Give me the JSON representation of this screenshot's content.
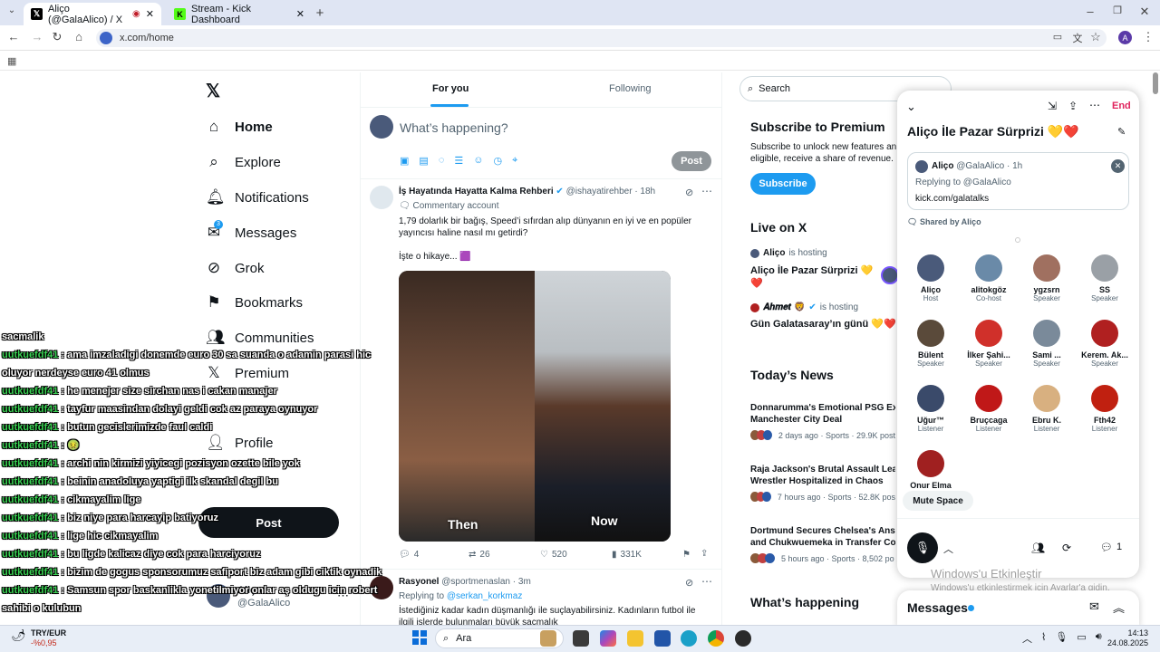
{
  "browser": {
    "tabs": [
      {
        "title": "Aliço (@GalaAlico) / X",
        "active": true
      },
      {
        "title": "Stream - Kick Dashboard",
        "active": false
      }
    ],
    "url": "x.com/home",
    "profile_initial": "A"
  },
  "nav": {
    "items": [
      {
        "label": "Home"
      },
      {
        "label": "Explore"
      },
      {
        "label": "Notifications"
      },
      {
        "label": "Messages",
        "badge": "3"
      },
      {
        "label": "Grok"
      },
      {
        "label": "Bookmarks"
      },
      {
        "label": "Communities"
      },
      {
        "label": "Premium"
      },
      {
        "label": "Profile"
      }
    ],
    "post_label": "Post",
    "account_handle": "@GalaAlico",
    "account_name": "Aliço"
  },
  "chat": {
    "lines": [
      {
        "user": "",
        "text": "sacmalik"
      },
      {
        "user": "uutkuefdf41",
        "text": " : ama imzaladigi donemde euro 30 sa suanda o adamin parasi hic"
      },
      {
        "user": "",
        "text": "oluyor nerdeyse euro 41 olmus"
      },
      {
        "user": "uutkuefdf41",
        "text": " : he menejer size sirchan nas i cakan manajer"
      },
      {
        "user": "uutkuefdf41",
        "text": " : tayfur maasindan dolayi geldi cok az paraya oynuyor"
      },
      {
        "user": "uutkuefdf41",
        "text": " : butun gecislerimizde faul caldi"
      },
      {
        "user": "uutkuefdf41",
        "text": " : 🤢"
      },
      {
        "user": "uutkuefdf41",
        "text": " : archi nin kirmizi yiyicegi pozisyon ozette bile yok"
      },
      {
        "user": "uutkuefdf41",
        "text": " : beinin anadoluya yaptigi ilk skandal degil bu"
      },
      {
        "user": "uutkuefdf41",
        "text": " : cikmayalim lige"
      },
      {
        "user": "uutkuefdf41",
        "text": " : biz niye para harcayip batiyoruz"
      },
      {
        "user": "uutkuefdf41",
        "text": " : lige hic cikmayalim"
      },
      {
        "user": "uutkuefdf41",
        "text": " : bu ligde kalicaz diye cok para harciyoruz"
      },
      {
        "user": "uutkuefdf41",
        "text": " : bizim de gogus sponsorumuz safiport biz adam gibi ciktik oynadik"
      },
      {
        "user": "uutkuefdf41",
        "text": " : Samsun spor baskanlikla yonetilmiyor onlar aş oldugu icin robert"
      },
      {
        "user": "",
        "text": "sahibi o kulubun"
      }
    ]
  },
  "timeline": {
    "tabs": [
      {
        "label": "For you",
        "active": true
      },
      {
        "label": "Following",
        "active": false
      }
    ],
    "composer_placeholder": "What’s happening?",
    "post_label": "Post",
    "tweet1": {
      "name": "İş Hayatında Hayatta Kalma Rehberi",
      "handle": "@ishayatirehber",
      "time": "· 18h",
      "badge": "Commentary account",
      "text": "1,79 dolarlık bir bağış, Speed’i sıfırdan alıp dünyanın en iyi ve en popüler yayıncısı haline nasıl mı getirdi?",
      "text2": "İşte o hikaye... 🟪",
      "img_left": "Then",
      "img_right": "Now",
      "replies": "4",
      "reposts": "26",
      "likes": "520",
      "views": "331K"
    },
    "tweet2": {
      "name": "Rasyonel",
      "handle": "@sportmenaslan",
      "time": "· 3m",
      "reply_to_prefix": "Replying to ",
      "reply_to": "@serkan_korkmaz",
      "text": "İstediğiniz kadar kadın düşmanlığı ile suçlayabilirsiniz. Kadınların futbol ile ilgili islerde bulunmaları büyük saçmalık"
    }
  },
  "right": {
    "search_placeholder": "Search",
    "premium_title": "Subscribe to Premium",
    "premium_text1": "Subscribe to unlock new features an",
    "premium_text2": "eligible, receive a share of revenue.",
    "subscribe_label": "Subscribe",
    "live_title": "Live on X",
    "live": [
      {
        "host": "Aliço",
        "status": "is hosting",
        "title": "Aliço İle Pazar Sürprizi 💛",
        "title2": "❤️"
      },
      {
        "host": "𝑨𝒉𝒎𝒆𝒕 🦁",
        "status": "is hosting",
        "title": "Gün Galatasaray’ın günü 💛❤️",
        "title2": ""
      }
    ],
    "news_title": "Today’s News",
    "news": [
      {
        "title": "Donnarumma's Emotional PSG Exi",
        "title2": "Manchester City Deal",
        "meta": "2 days ago · Sports · 29.9K post"
      },
      {
        "title": "Raja Jackson's Brutal Assault Leav",
        "title2": "Wrestler Hospitalized in Chaos",
        "meta": "7 hours ago · Sports · 52.8K pos"
      },
      {
        "title": "Dortmund Secures Chelsea's Ansc",
        "title2": "and Chukwuemeka in Transfer Co",
        "meta": "5 hours ago · Sports · 8,502 po"
      }
    ],
    "happening_title": "What’s happening"
  },
  "space": {
    "end_label": "End",
    "title": "Aliço İle Pazar Sürprizi 💛❤️",
    "shared_name": "Aliço",
    "shared_handle": "@GalaAlico · 1h",
    "shared_reply": "Replying to @GalaAlico",
    "shared_link": "kick.com/galatalks",
    "shared_by": "Shared by Aliço",
    "participants": [
      {
        "name": "Aliço",
        "role": "Host",
        "color": "#4a5a7a"
      },
      {
        "name": "alitokgöz",
        "role": "Co-host",
        "color": "#6a8aa8"
      },
      {
        "name": "ygzsrn",
        "role": "Speaker",
        "color": "#a07060"
      },
      {
        "name": "SS",
        "role": "Speaker",
        "color": "#9aa0a6"
      },
      {
        "name": "Bülent",
        "role": "Speaker",
        "color": "#5a4a3a"
      },
      {
        "name": "İlker Şahi...",
        "role": "Speaker",
        "color": "#d0302a"
      },
      {
        "name": "Sami ...",
        "role": "Speaker",
        "color": "#7a8a9a"
      },
      {
        "name": "Kerem. Ak...",
        "role": "Speaker",
        "color": "#b02020"
      },
      {
        "name": "Uğur™",
        "role": "Listener",
        "color": "#3a4a6a"
      },
      {
        "name": "Bruçcaga",
        "role": "Listener",
        "color": "#c01818"
      },
      {
        "name": "Ebru K.",
        "role": "Listener",
        "color": "#d8b080"
      },
      {
        "name": "Fth42",
        "role": "Listener",
        "color": "#c02010"
      },
      {
        "name": "Onur Elma",
        "role": "",
        "color": "#a02020"
      }
    ],
    "mute_label": "Mute Space",
    "comment_count": "1",
    "watermark1": "Windows'u Etkinleştir",
    "watermark2": "Windows'u etkinleştirmek için Ayarlar'a gidin."
  },
  "messages_dock": {
    "title": "Messages"
  },
  "taskbar": {
    "currency": "TRY/EUR",
    "change": "-%0,95",
    "search": "Ara",
    "time": "14:13",
    "date": "24.08.2025"
  }
}
